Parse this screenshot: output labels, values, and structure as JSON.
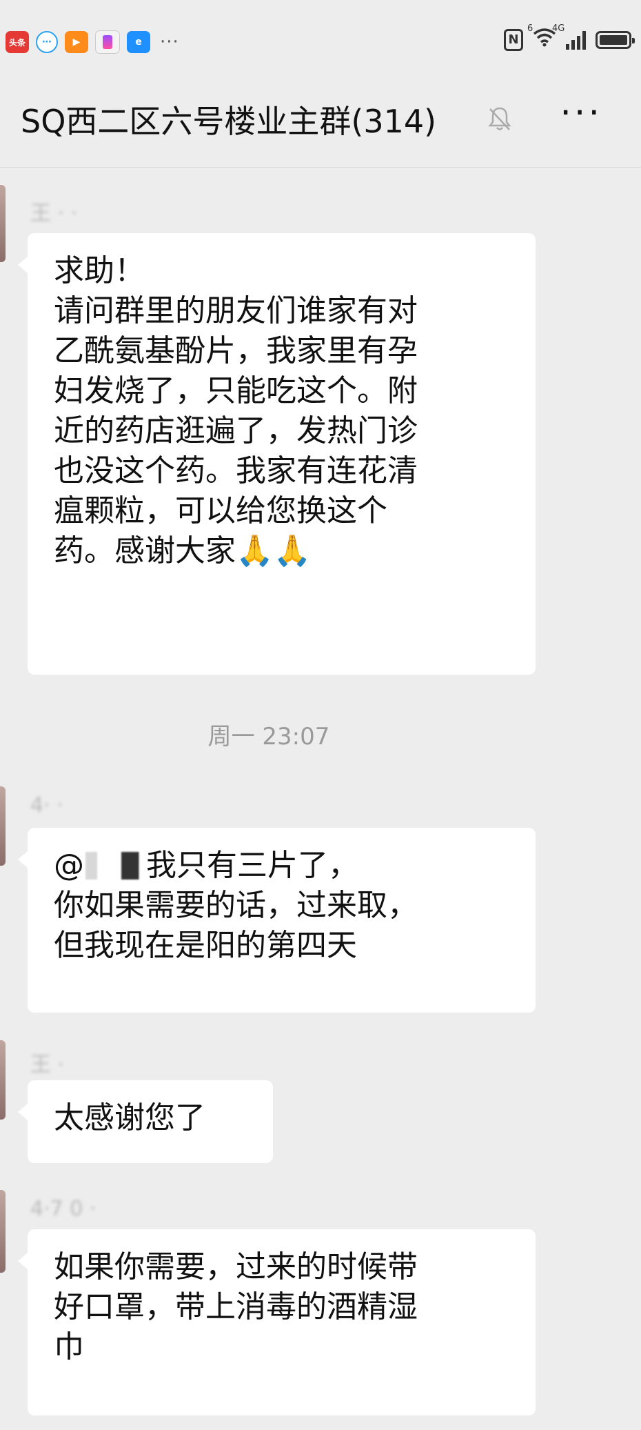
{
  "status_bar": {
    "app_icons": [
      "toutiao-icon",
      "chat-bubble-icon",
      "video-icon",
      "iqiyi-icon",
      "browser-icon"
    ],
    "toutiao_label": "头条",
    "more": "···",
    "wifi_badge": "6",
    "signal_badge": "4G"
  },
  "header": {
    "title": "SQ西二区六号楼业主群(314)",
    "more": "···"
  },
  "messages": [
    {
      "sender": "王 · ·",
      "lines": [
        "求助！",
        "请问群里的朋友们谁家有对",
        "乙酰氨基酚片，我家里有孕",
        "妇发烧了，只能吃这个。附",
        "近的药店逛遍了，发热门诊",
        "也没这个药。我家有连花清",
        "瘟颗粒，可以给您换这个",
        "药。感谢大家🙏🙏"
      ]
    },
    {
      "sender": "4· ·",
      "mention": "@",
      "lines": [
        "我只有三片了，",
        "你如果需要的话，过来取，",
        "但我现在是阳的第四天"
      ]
    },
    {
      "sender": "王 ·",
      "lines": [
        "太感谢您了"
      ]
    },
    {
      "sender": "4·7 0 ·",
      "lines": [
        "如果你需要，过来的时候带",
        "好口罩，带上消毒的酒精湿",
        "巾"
      ]
    }
  ],
  "timestamp": "周一 23:07",
  "colors": {
    "background": "#ededed",
    "bubble": "#ffffff",
    "timestamp_text": "#9a9a9a"
  }
}
